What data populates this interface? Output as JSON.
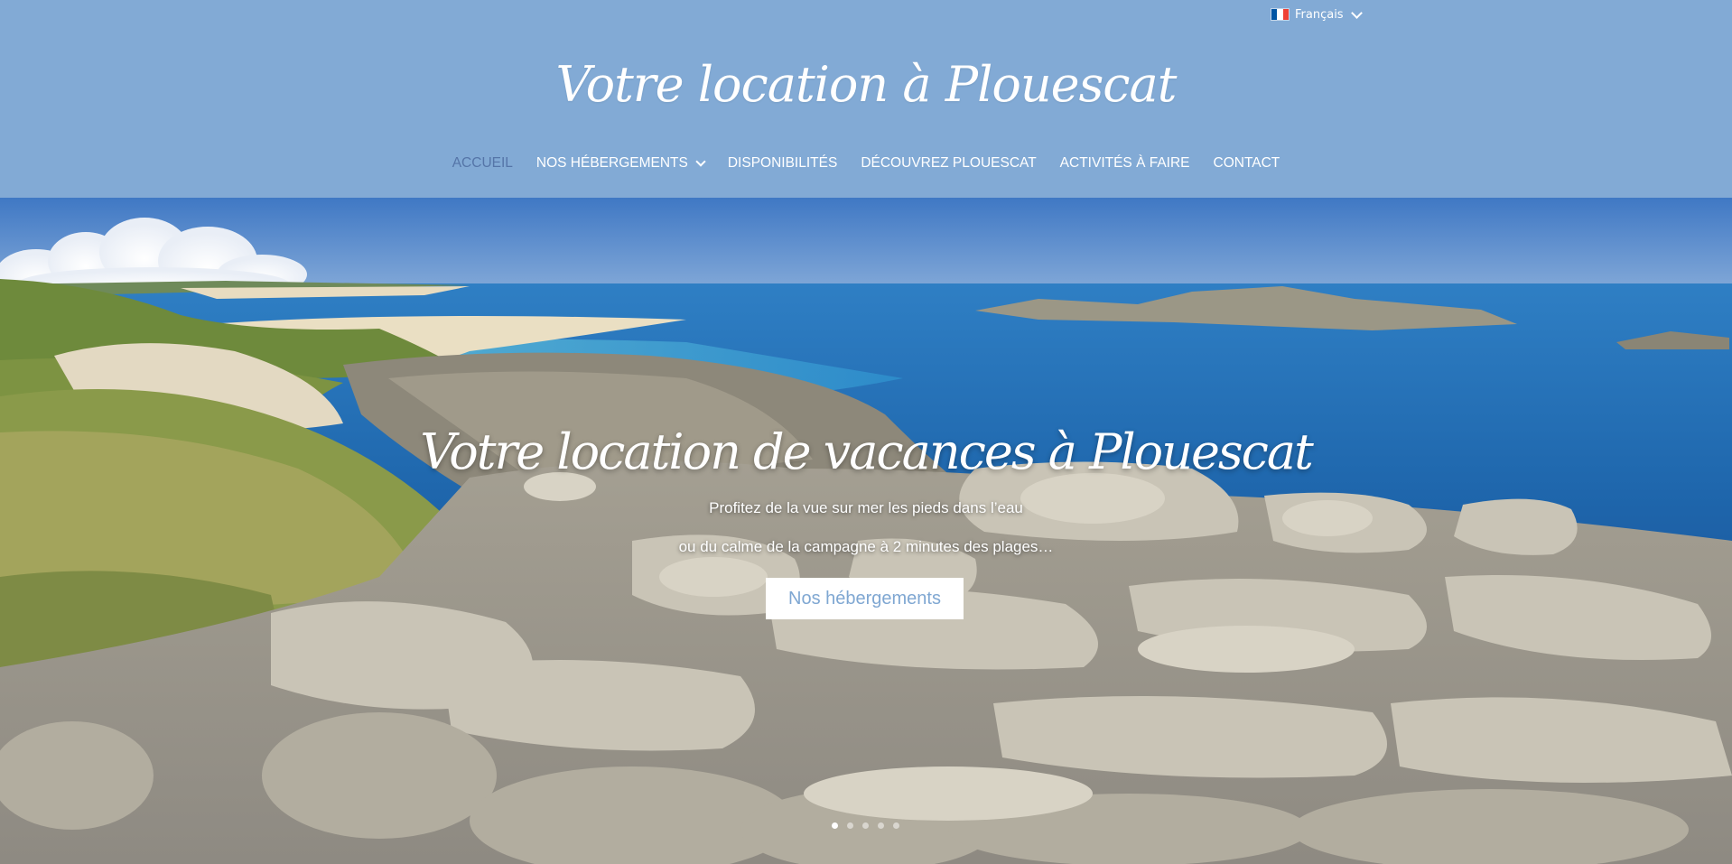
{
  "language": {
    "label": "Français",
    "flag_colors": [
      "#0055a4",
      "#ffffff",
      "#ef4135"
    ]
  },
  "site": {
    "title": "Votre location à Plouescat"
  },
  "nav": {
    "items": [
      {
        "label": "ACCUEIL",
        "active": true,
        "has_dropdown": false
      },
      {
        "label": "NOS HÉBERGEMENTS",
        "active": false,
        "has_dropdown": true
      },
      {
        "label": "DISPONIBILITÉS",
        "active": false,
        "has_dropdown": false
      },
      {
        "label": "DÉCOUVREZ PLOUESCAT",
        "active": false,
        "has_dropdown": false
      },
      {
        "label": "ACTIVITÉS À FAIRE",
        "active": false,
        "has_dropdown": false
      },
      {
        "label": "CONTACT",
        "active": false,
        "has_dropdown": false
      }
    ]
  },
  "hero": {
    "title": "Votre location de vacances à Plouescat",
    "line1": "Profitez de la vue sur mer les pieds dans l’eau",
    "line2": "ou du calme de la campagne à 2 minutes des plages…",
    "button": "Nos hébergements",
    "slides_total": 5,
    "active_slide": 1
  },
  "colors": {
    "header_bg": "#82aad5",
    "accent": "#7fa7d2",
    "active_nav": "#5575a8"
  }
}
